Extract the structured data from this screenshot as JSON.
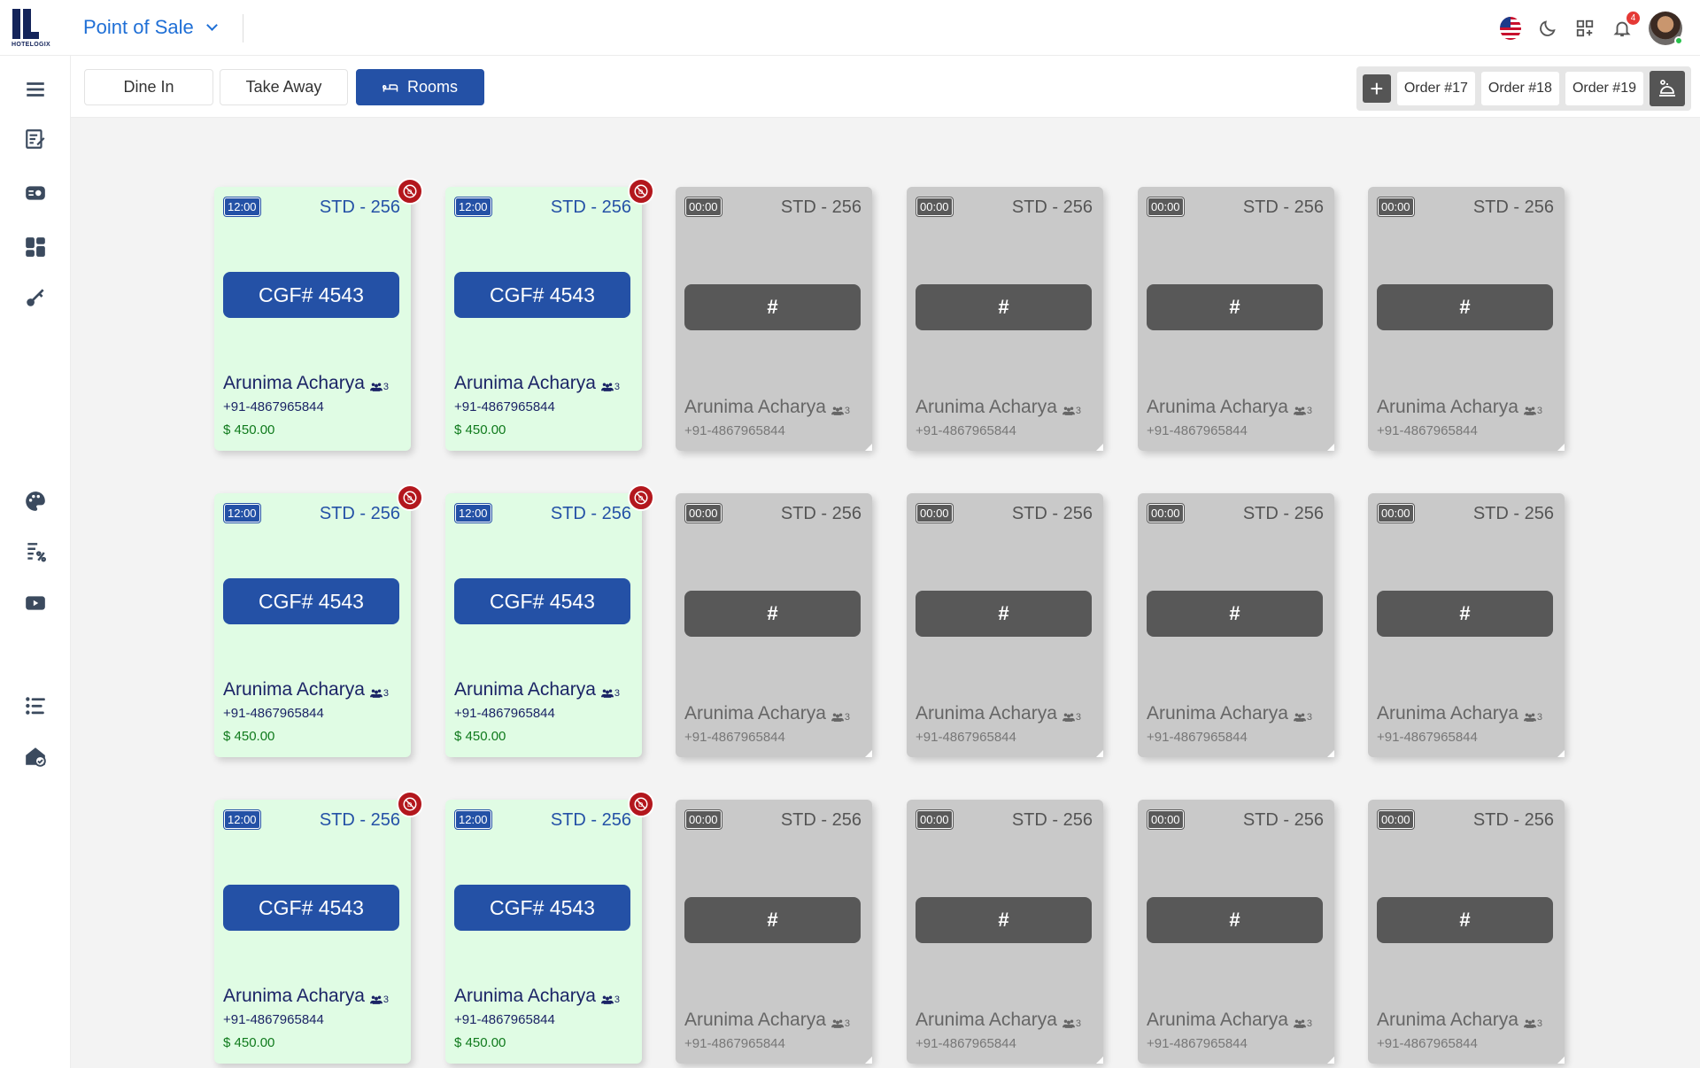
{
  "header": {
    "logo_text": "HOTELOGIX",
    "module_title": "Point of Sale",
    "notification_count": "4",
    "icons": [
      "us-flag-icon",
      "dark-mode-moon-icon",
      "apps-grid-icon",
      "bell-icon",
      "user-avatar"
    ]
  },
  "sidebar": {
    "icons": [
      "menu-hamburger-icon",
      "checklist-edit-icon",
      "id-card-icon",
      "dashboard-icon",
      "key-icon",
      "palette-icon",
      "bill-discount-icon",
      "video-play-icon",
      "list-settings-icon",
      "home-check-icon"
    ]
  },
  "tabs": [
    {
      "label": "Dine In",
      "active": false
    },
    {
      "label": "Take Away",
      "active": false
    },
    {
      "label": "Rooms",
      "active": true
    }
  ],
  "orders": [
    "Order #17",
    "Order #18",
    "Order #19"
  ],
  "colors": {
    "primary": "#2451a6",
    "occupied_bg": "#e0fce4",
    "vacant_bg": "#c9c9c9",
    "vacant_button": "#585858",
    "amount_green": "#0f7a1c",
    "dnd_red": "#b3171d",
    "title_blue": "#1f6fd6"
  },
  "rooms": [
    {
      "status": "occupied",
      "time": "12:00",
      "room": "STD - 256",
      "code": "CGF# 4543",
      "guest": "Arunima Acharya",
      "pax": "3",
      "phone": "+91-4867965844",
      "amount": "$ 450.00",
      "dnd": true
    },
    {
      "status": "occupied",
      "time": "12:00",
      "room": "STD - 256",
      "code": "CGF# 4543",
      "guest": "Arunima Acharya",
      "pax": "3",
      "phone": "+91-4867965844",
      "amount": "$ 450.00",
      "dnd": true
    },
    {
      "status": "vacant",
      "time": "00:00",
      "room": "STD - 256",
      "code": "#",
      "guest": "Arunima Acharya",
      "pax": "3",
      "phone": "+91-4867965844"
    },
    {
      "status": "vacant",
      "time": "00:00",
      "room": "STD - 256",
      "code": "#",
      "guest": "Arunima Acharya",
      "pax": "3",
      "phone": "+91-4867965844"
    },
    {
      "status": "vacant",
      "time": "00:00",
      "room": "STD - 256",
      "code": "#",
      "guest": "Arunima Acharya",
      "pax": "3",
      "phone": "+91-4867965844"
    },
    {
      "status": "vacant",
      "time": "00:00",
      "room": "STD - 256",
      "code": "#",
      "guest": "Arunima Acharya",
      "pax": "3",
      "phone": "+91-4867965844"
    },
    {
      "status": "occupied",
      "time": "12:00",
      "room": "STD - 256",
      "code": "CGF# 4543",
      "guest": "Arunima Acharya",
      "pax": "3",
      "phone": "+91-4867965844",
      "amount": "$ 450.00",
      "dnd": true
    },
    {
      "status": "occupied",
      "time": "12:00",
      "room": "STD - 256",
      "code": "CGF# 4543",
      "guest": "Arunima Acharya",
      "pax": "3",
      "phone": "+91-4867965844",
      "amount": "$ 450.00",
      "dnd": true
    },
    {
      "status": "vacant",
      "time": "00:00",
      "room": "STD - 256",
      "code": "#",
      "guest": "Arunima Acharya",
      "pax": "3",
      "phone": "+91-4867965844"
    },
    {
      "status": "vacant",
      "time": "00:00",
      "room": "STD - 256",
      "code": "#",
      "guest": "Arunima Acharya",
      "pax": "3",
      "phone": "+91-4867965844"
    },
    {
      "status": "vacant",
      "time": "00:00",
      "room": "STD - 256",
      "code": "#",
      "guest": "Arunima Acharya",
      "pax": "3",
      "phone": "+91-4867965844"
    },
    {
      "status": "vacant",
      "time": "00:00",
      "room": "STD - 256",
      "code": "#",
      "guest": "Arunima Acharya",
      "pax": "3",
      "phone": "+91-4867965844"
    },
    {
      "status": "occupied",
      "time": "12:00",
      "room": "STD - 256",
      "code": "CGF# 4543",
      "guest": "Arunima Acharya",
      "pax": "3",
      "phone": "+91-4867965844",
      "amount": "$ 450.00",
      "dnd": true
    },
    {
      "status": "occupied",
      "time": "12:00",
      "room": "STD - 256",
      "code": "CGF# 4543",
      "guest": "Arunima Acharya",
      "pax": "3",
      "phone": "+91-4867965844",
      "amount": "$ 450.00",
      "dnd": true
    },
    {
      "status": "vacant",
      "time": "00:00",
      "room": "STD - 256",
      "code": "#",
      "guest": "Arunima Acharya",
      "pax": "3",
      "phone": "+91-4867965844"
    },
    {
      "status": "vacant",
      "time": "00:00",
      "room": "STD - 256",
      "code": "#",
      "guest": "Arunima Acharya",
      "pax": "3",
      "phone": "+91-4867965844"
    },
    {
      "status": "vacant",
      "time": "00:00",
      "room": "STD - 256",
      "code": "#",
      "guest": "Arunima Acharya",
      "pax": "3",
      "phone": "+91-4867965844"
    },
    {
      "status": "vacant",
      "time": "00:00",
      "room": "STD - 256",
      "code": "#",
      "guest": "Arunima Acharya",
      "pax": "3",
      "phone": "+91-4867965844"
    }
  ]
}
